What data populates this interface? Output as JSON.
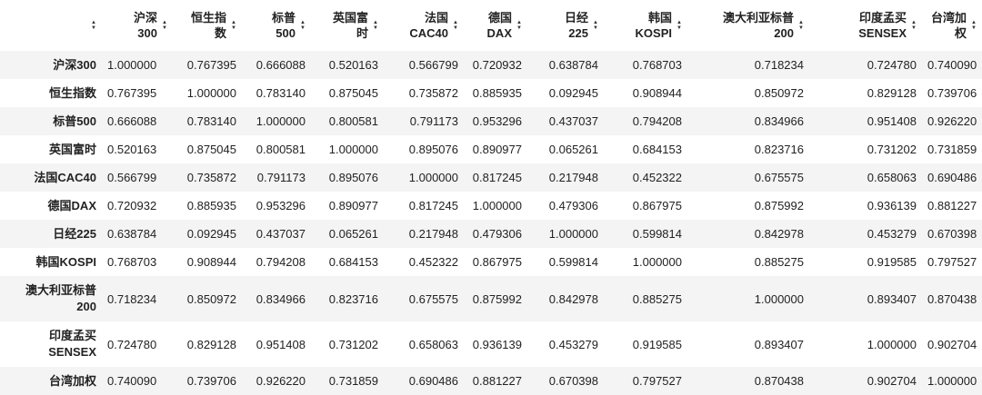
{
  "columns": [
    {
      "line1": "沪深",
      "line2": "300"
    },
    {
      "line1": "恒生指",
      "line2": "数"
    },
    {
      "line1": "标普",
      "line2": "500"
    },
    {
      "line1": "英国富",
      "line2": "时"
    },
    {
      "line1": "法国",
      "line2": "CAC40"
    },
    {
      "line1": "德国",
      "line2": "DAX"
    },
    {
      "line1": "日经",
      "line2": "225"
    },
    {
      "line1": "韩国",
      "line2": "KOSPI"
    },
    {
      "line1": "澳大利亚标普",
      "line2": "200"
    },
    {
      "line1": "印度孟买",
      "line2": "SENSEX"
    },
    {
      "line1": "台湾加",
      "line2": "权"
    }
  ],
  "rows": [
    {
      "label1": "沪深300",
      "label2": "",
      "values": [
        "1.000000",
        "0.767395",
        "0.666088",
        "0.520163",
        "0.566799",
        "0.720932",
        "0.638784",
        "0.768703",
        "0.718234",
        "0.724780",
        "0.740090"
      ]
    },
    {
      "label1": "恒生指数",
      "label2": "",
      "values": [
        "0.767395",
        "1.000000",
        "0.783140",
        "0.875045",
        "0.735872",
        "0.885935",
        "0.092945",
        "0.908944",
        "0.850972",
        "0.829128",
        "0.739706"
      ]
    },
    {
      "label1": "标普500",
      "label2": "",
      "values": [
        "0.666088",
        "0.783140",
        "1.000000",
        "0.800581",
        "0.791173",
        "0.953296",
        "0.437037",
        "0.794208",
        "0.834966",
        "0.951408",
        "0.926220"
      ]
    },
    {
      "label1": "英国富时",
      "label2": "",
      "values": [
        "0.520163",
        "0.875045",
        "0.800581",
        "1.000000",
        "0.895076",
        "0.890977",
        "0.065261",
        "0.684153",
        "0.823716",
        "0.731202",
        "0.731859"
      ]
    },
    {
      "label1": "法国CAC40",
      "label2": "",
      "values": [
        "0.566799",
        "0.735872",
        "0.791173",
        "0.895076",
        "1.000000",
        "0.817245",
        "0.217948",
        "0.452322",
        "0.675575",
        "0.658063",
        "0.690486"
      ]
    },
    {
      "label1": "德国DAX",
      "label2": "",
      "values": [
        "0.720932",
        "0.885935",
        "0.953296",
        "0.890977",
        "0.817245",
        "1.000000",
        "0.479306",
        "0.867975",
        "0.875992",
        "0.936139",
        "0.881227"
      ]
    },
    {
      "label1": "日经225",
      "label2": "",
      "values": [
        "0.638784",
        "0.092945",
        "0.437037",
        "0.065261",
        "0.217948",
        "0.479306",
        "1.000000",
        "0.599814",
        "0.842978",
        "0.453279",
        "0.670398"
      ]
    },
    {
      "label1": "韩国KOSPI",
      "label2": "",
      "values": [
        "0.768703",
        "0.908944",
        "0.794208",
        "0.684153",
        "0.452322",
        "0.867975",
        "0.599814",
        "1.000000",
        "0.885275",
        "0.919585",
        "0.797527"
      ]
    },
    {
      "label1": "澳大利亚标普",
      "label2": "200",
      "values": [
        "0.718234",
        "0.850972",
        "0.834966",
        "0.823716",
        "0.675575",
        "0.875992",
        "0.842978",
        "0.885275",
        "1.000000",
        "0.893407",
        "0.870438"
      ]
    },
    {
      "label1": "印度孟买",
      "label2": "SENSEX",
      "values": [
        "0.724780",
        "0.829128",
        "0.951408",
        "0.731202",
        "0.658063",
        "0.936139",
        "0.453279",
        "0.919585",
        "0.893407",
        "1.000000",
        "0.902704"
      ]
    },
    {
      "label1": "台湾加权",
      "label2": "",
      "values": [
        "0.740090",
        "0.739706",
        "0.926220",
        "0.731859",
        "0.690486",
        "0.881227",
        "0.670398",
        "0.797527",
        "0.870438",
        "0.902704",
        "1.000000"
      ]
    }
  ]
}
